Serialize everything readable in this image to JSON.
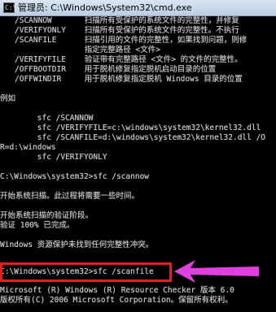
{
  "window": {
    "title": "管理员: C:\\Windows\\System32\\cmd.exe",
    "icon_text": "C:\\"
  },
  "console": {
    "lines": [
      "/SCANNOW       扫描所有受保护的系统文件的完整性，并修复",
      "/VERIFYONLY    扫描所有受保护的系统文件的完整性。不执行",
      "/SCANFILE      扫描引用的文件的完整性，如果找到问题，则修",
      "               指定完整路径 <文件>",
      "/VERIFYFILE    验证带有完整路径 <文件> 的文件的完整性。",
      "/OFFBOOTDIR    用于脱机修复指定脱机启动目录的位置",
      "/OFFWINDIR     用于脱机修复指定脱机 Windows 目录的位置",
      "",
      "例如",
      "",
      "        sfc /SCANNOW",
      "        sfc /VERIFYFILE=c:\\windows\\system32\\kernel32.dll",
      "        sfc /SCANFILE=d:\\windows\\system32\\kernel32.dll /O",
      "R=d:\\windows",
      "        sfc /VERIFYONLY",
      "",
      "C:\\Windows\\system32>sfc /scannow",
      "",
      "开始系统扫描。此过程将需要一些时间。",
      "",
      "开始系统扫描的验证阶段。",
      "验证 100% 已完成。",
      "",
      "Windows 资源保护未找到任何完整性冲突。",
      "",
      "C:\\Windows\\system32>sfc /scanfile",
      "",
      "Microsoft (R) Windows (R) Resource Checker 版本 6.0",
      "版权所有(C) 2006 Microsoft Corporation。保留所有权利。"
    ]
  },
  "annotation": {
    "box_color": "#e0201e",
    "arrow_color": "#e040e0"
  }
}
